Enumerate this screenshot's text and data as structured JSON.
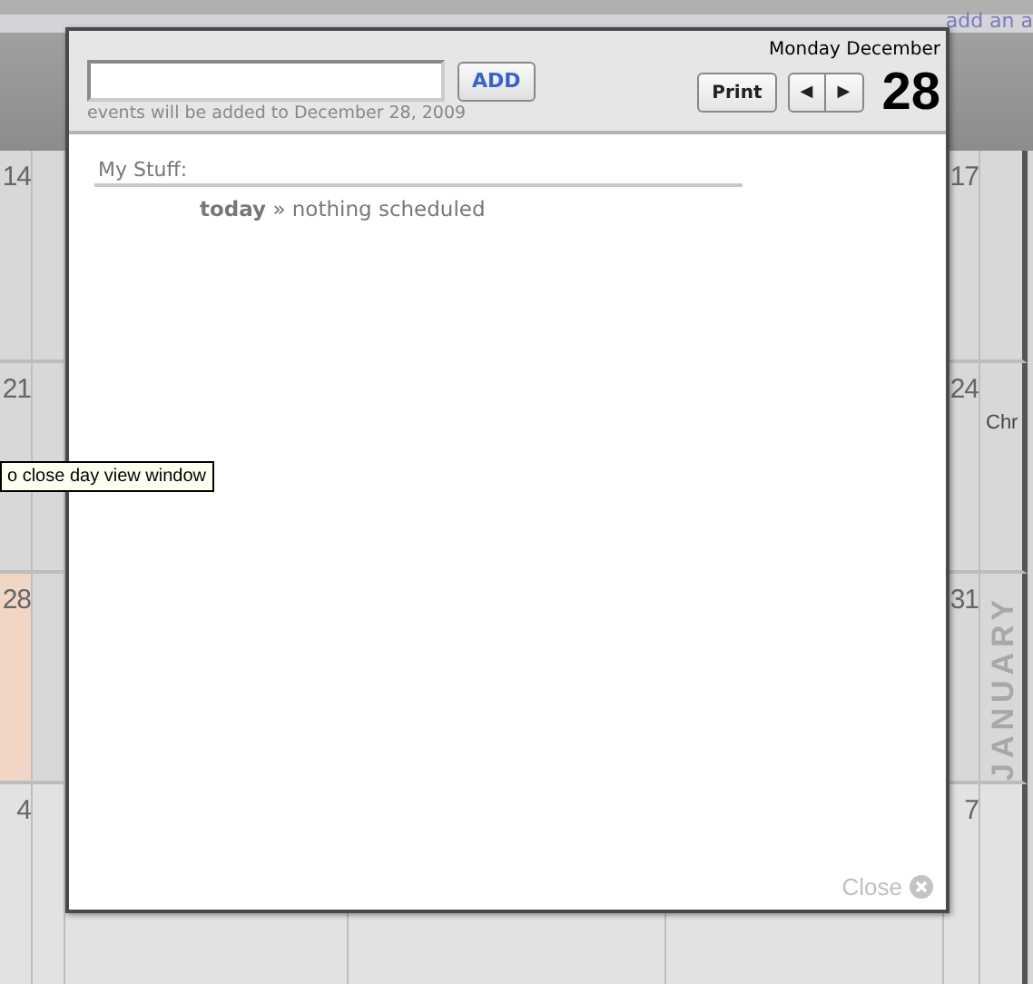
{
  "calendar": {
    "top_link": "add an a",
    "weeks": [
      {
        "left_date": "14",
        "left_today": false,
        "right_date": "17"
      },
      {
        "left_date": "21",
        "left_today": false,
        "right_date": "24",
        "right_text": "Chr"
      },
      {
        "left_date": "28",
        "left_today": true,
        "right_date": "31",
        "month_label": "JANUARY"
      },
      {
        "left_date": "4",
        "left_today": false,
        "right_date": "7"
      }
    ]
  },
  "tooltip": "o close day view window",
  "day_view": {
    "add_button": "ADD",
    "hint": "events will be added to December 28, 2009",
    "weekday_month": "Monday December",
    "print_button": "Print",
    "prev_icon": "◀",
    "next_icon": "▶",
    "day": "28",
    "section_title": "My Stuff:",
    "entry": "**today** » nothing scheduled",
    "close_link": "Close"
  }
}
